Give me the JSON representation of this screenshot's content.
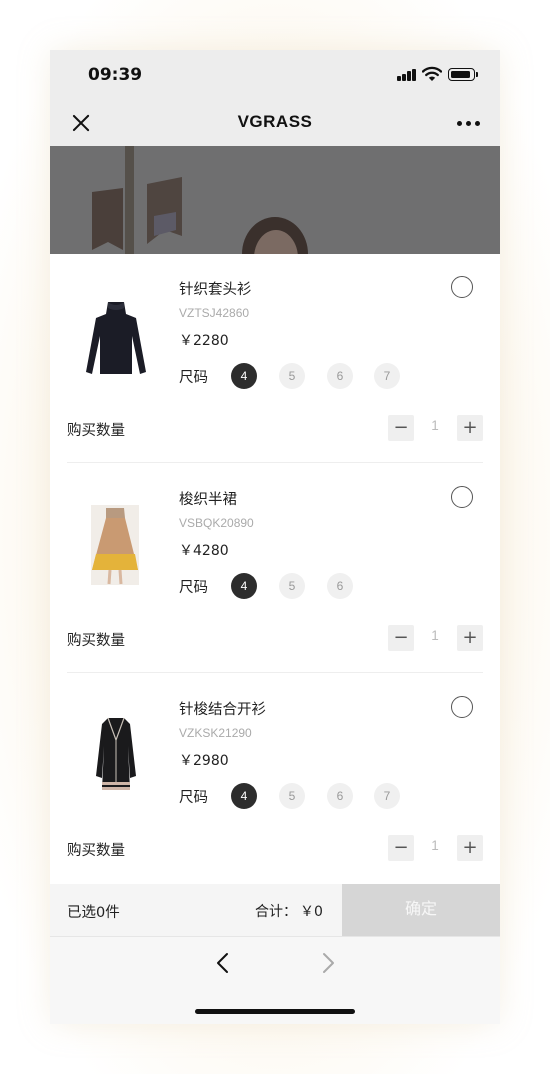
{
  "status_bar": {
    "time": "09:39"
  },
  "nav": {
    "title": "VGRASS"
  },
  "products": [
    {
      "name": "针织套头衫",
      "code": "VZTSJ42860",
      "price": "￥2280",
      "size_label": "尺码",
      "sizes": [
        "4",
        "5",
        "6",
        "7"
      ],
      "selected_size": "4",
      "qty_label": "购买数量",
      "qty": "1",
      "minus": "−",
      "plus": "+"
    },
    {
      "name": "梭织半裙",
      "code": "VSBQK20890",
      "price": "￥4280",
      "size_label": "尺码",
      "sizes": [
        "4",
        "5",
        "6"
      ],
      "selected_size": "4",
      "qty_label": "购买数量",
      "qty": "1",
      "minus": "−",
      "plus": "+"
    },
    {
      "name": "针梭结合开衫",
      "code": "VZKSK21290",
      "price": "￥2980",
      "size_label": "尺码",
      "sizes": [
        "4",
        "5",
        "6",
        "7"
      ],
      "selected_size": "4",
      "qty_label": "购买数量",
      "qty": "1",
      "minus": "−",
      "plus": "+"
    }
  ],
  "footer": {
    "selected": "已选0件",
    "total_label": "合计：",
    "total_value": "￥0",
    "confirm": "确定"
  },
  "icons": {
    "close": "close-icon",
    "more": "more-icon",
    "back": "chevron-left-icon",
    "forward": "chevron-right-icon"
  },
  "colors": {
    "selected_size": "#2d2d2d",
    "confirm_disabled": "#d6d6d6",
    "nav_bg": "#ededed"
  }
}
